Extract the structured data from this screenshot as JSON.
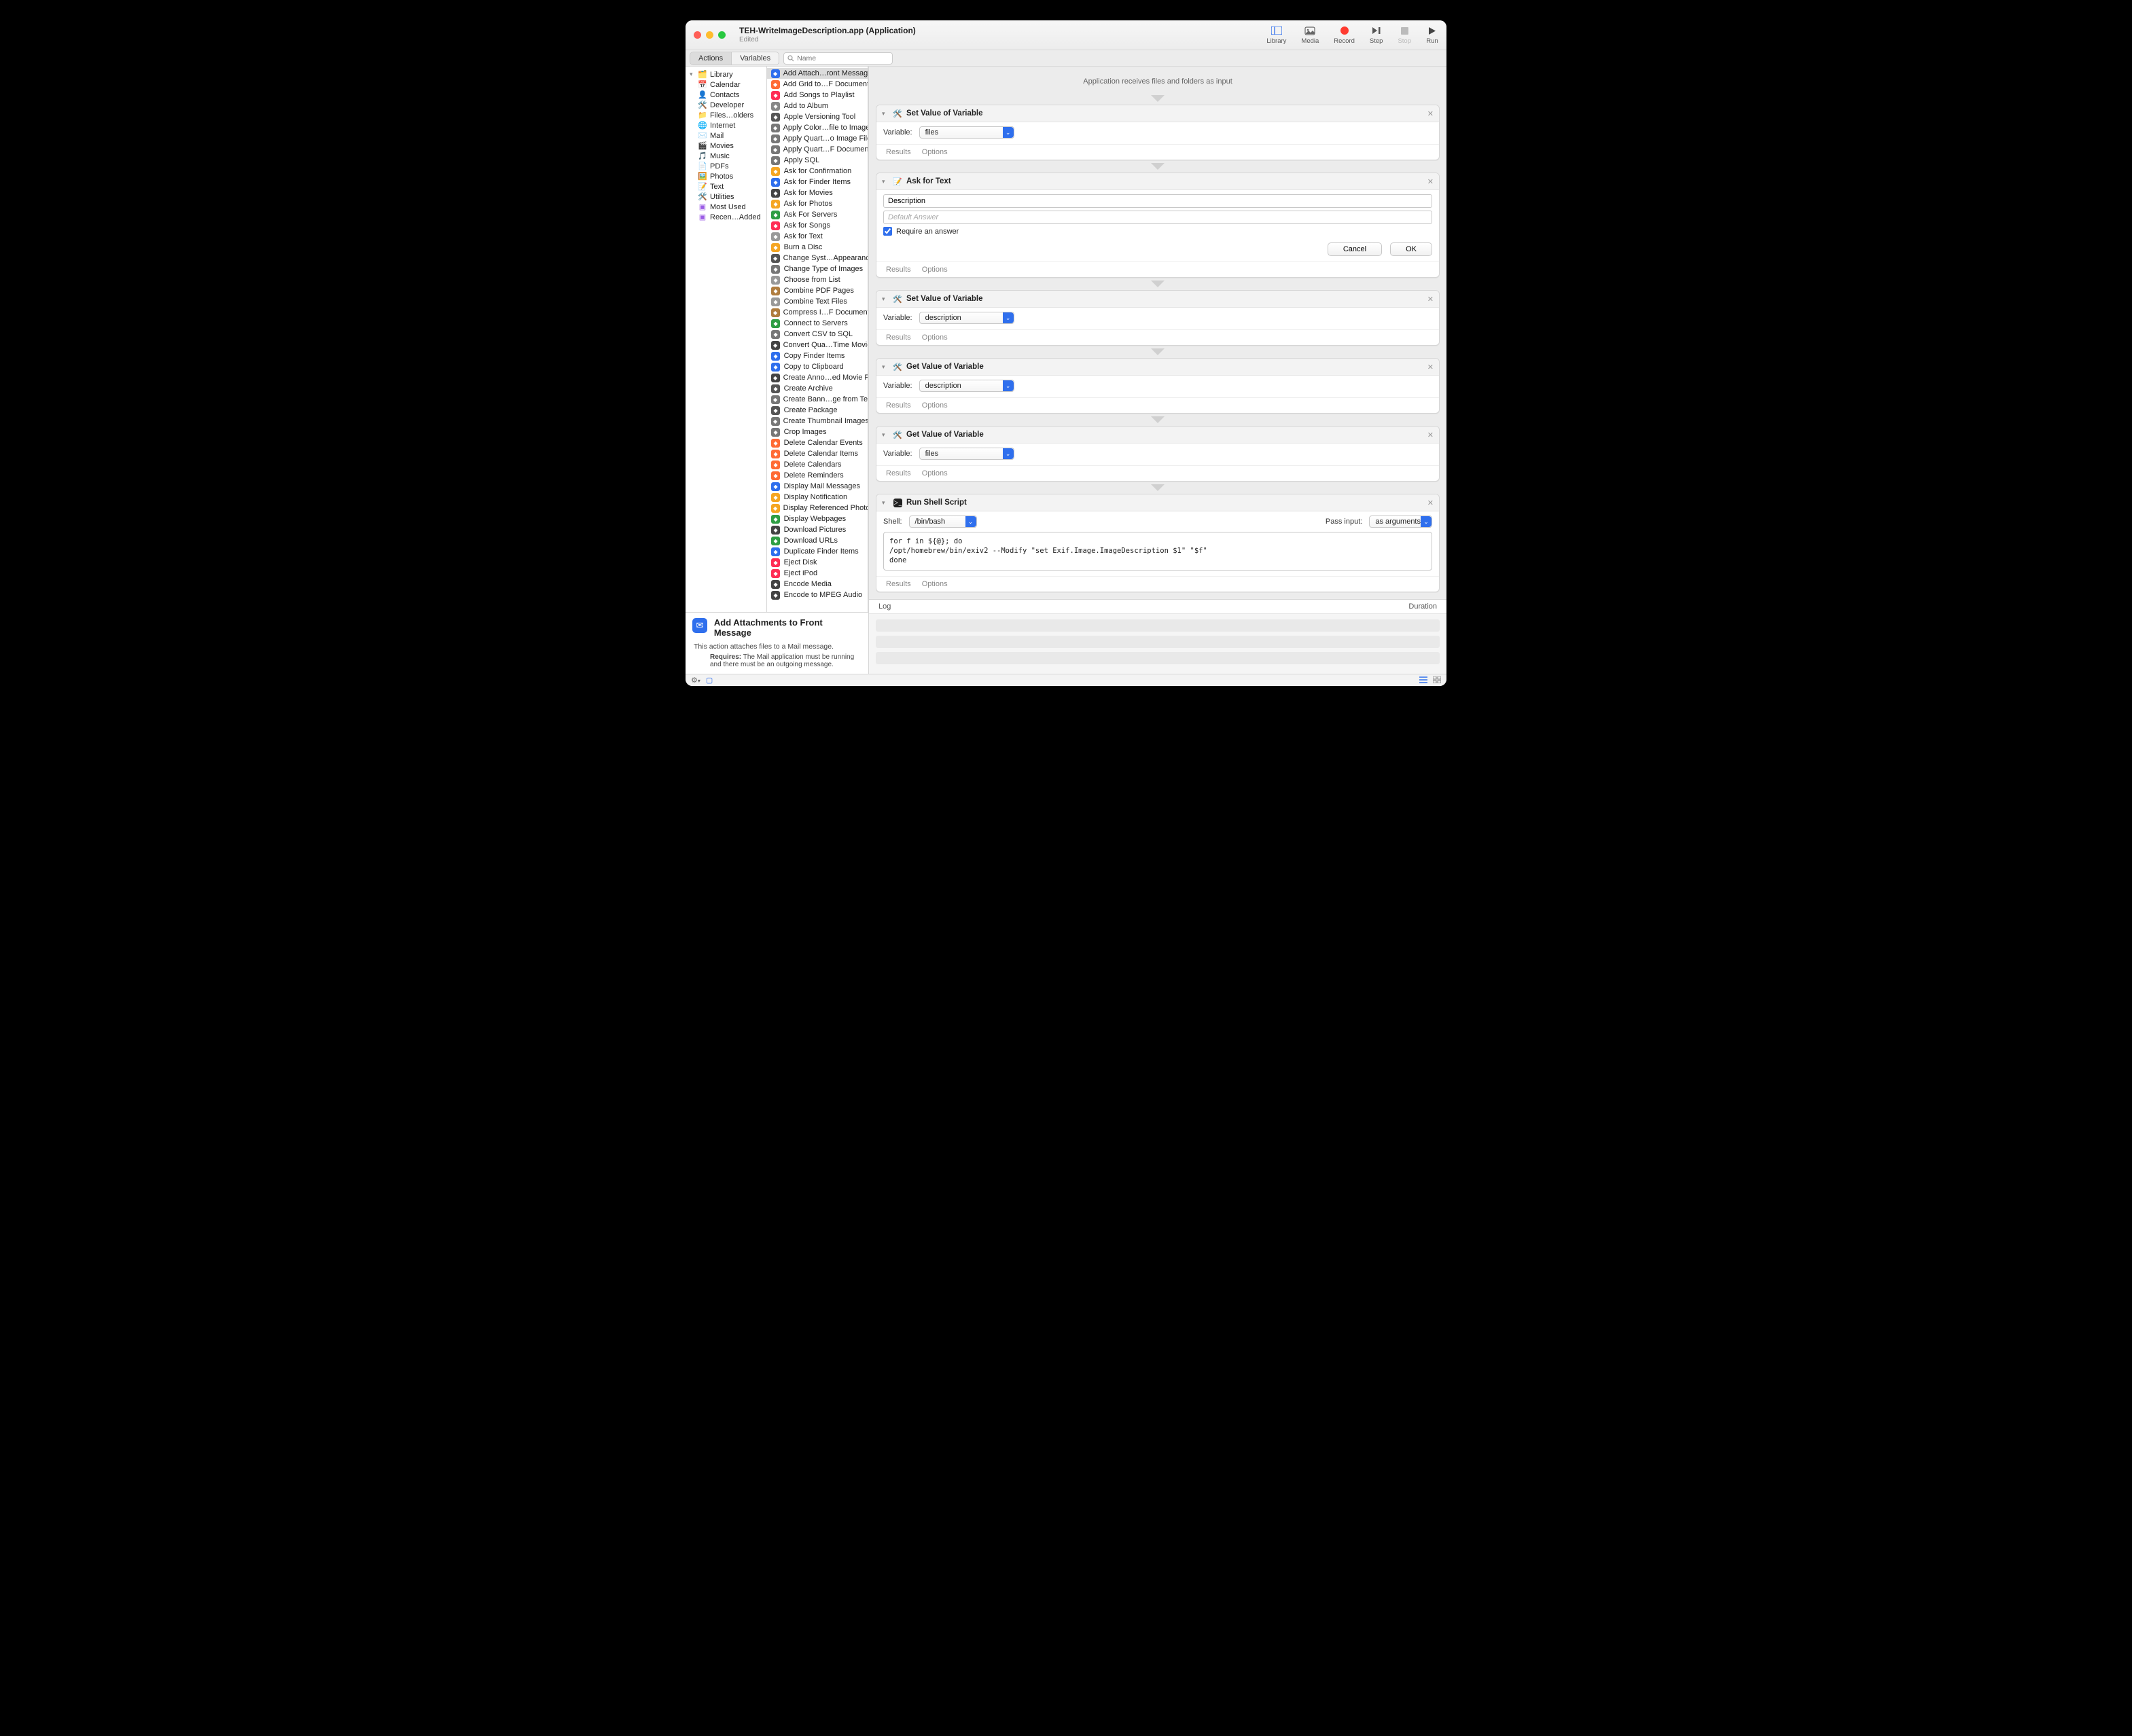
{
  "window": {
    "title": "TEH-WriteImageDescription.app (Application)",
    "subtitle": "Edited"
  },
  "toolbar": {
    "library": "Library",
    "media": "Media",
    "record": "Record",
    "step": "Step",
    "stop": "Stop",
    "run": "Run"
  },
  "tabs": {
    "actions": "Actions",
    "variables": "Variables"
  },
  "search": {
    "placeholder": "Name"
  },
  "library": {
    "root": "Library",
    "items": [
      "Calendar",
      "Contacts",
      "Developer",
      "Files…olders",
      "Internet",
      "Mail",
      "Movies",
      "Music",
      "PDFs",
      "Photos",
      "Text",
      "Utilities"
    ],
    "extras": [
      "Most Used",
      "Recen…Added"
    ]
  },
  "actions": [
    "Add Attach…ront Message",
    "Add Grid to…F Documents",
    "Add Songs to Playlist",
    "Add to Album",
    "Apple Versioning Tool",
    "Apply Color…file to Images",
    "Apply Quart…o Image Files",
    "Apply Quart…F Documents",
    "Apply SQL",
    "Ask for Confirmation",
    "Ask for Finder Items",
    "Ask for Movies",
    "Ask for Photos",
    "Ask For Servers",
    "Ask for Songs",
    "Ask for Text",
    "Burn a Disc",
    "Change Syst…Appearance",
    "Change Type of Images",
    "Choose from List",
    "Combine PDF Pages",
    "Combine Text Files",
    "Compress I…F Documents",
    "Connect to Servers",
    "Convert CSV to SQL",
    "Convert Qua…Time Movies",
    "Copy Finder Items",
    "Copy to Clipboard",
    "Create Anno…ed Movie File",
    "Create Archive",
    "Create Bann…ge from Text",
    "Create Package",
    "Create Thumbnail Images",
    "Crop Images",
    "Delete Calendar Events",
    "Delete Calendar Items",
    "Delete Calendars",
    "Delete Reminders",
    "Display Mail Messages",
    "Display Notification",
    "Display Referenced Photo",
    "Display Webpages",
    "Download Pictures",
    "Download URLs",
    "Duplicate Finder Items",
    "Eject Disk",
    "Eject iPod",
    "Encode Media",
    "Encode to MPEG Audio"
  ],
  "info": {
    "title": "Add Attachments to Front Message",
    "desc": "This action attaches files to a Mail message.",
    "req_label": "Requires:",
    "req_text": "The Mail application must be running and there must be an outgoing message."
  },
  "workflow": {
    "receives": "Application receives files and folders as input",
    "variable_label": "Variable:",
    "results": "Results",
    "options": "Options",
    "set_var_title": "Set Value of Variable",
    "get_var_title": "Get Value of Variable",
    "ask_text_title": "Ask for Text",
    "run_shell_title": "Run Shell Script",
    "ask": {
      "field1": "Description",
      "placeholder": "Default Answer",
      "require": "Require an answer",
      "cancel": "Cancel",
      "ok": "OK"
    },
    "vars": {
      "files": "files",
      "description": "description"
    },
    "shell": {
      "shell_label": "Shell:",
      "shell_value": "/bin/bash",
      "pass_label": "Pass input:",
      "pass_value": "as arguments",
      "code": "for f in ${@}; do\n/opt/homebrew/bin/exiv2 --Modify \"set Exif.Image.ImageDescription $1\" \"$f\"\ndone"
    }
  },
  "log": {
    "log": "Log",
    "duration": "Duration"
  }
}
